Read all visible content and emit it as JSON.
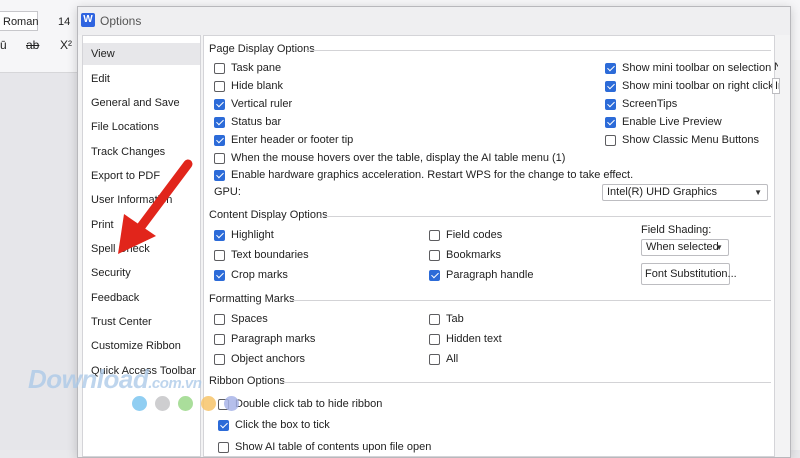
{
  "background": {
    "font_name": "Roman",
    "font_size": "14",
    "underline_glyph": "ū",
    "strike_label": "ab",
    "superscript_label": "X²"
  },
  "dialog": {
    "title": "Options",
    "app_icon_letter": "W"
  },
  "sidebar": {
    "items": [
      {
        "label": "View",
        "active": true
      },
      {
        "label": "Edit"
      },
      {
        "label": "General and Save"
      },
      {
        "label": "File Locations"
      },
      {
        "label": "Track Changes"
      },
      {
        "label": "Export to PDF"
      },
      {
        "label": "User Information"
      },
      {
        "label": "Print"
      },
      {
        "label": "Spell Check"
      },
      {
        "label": "Security"
      },
      {
        "label": "Feedback"
      },
      {
        "label": "Trust Center"
      },
      {
        "label": "Customize Ribbon"
      },
      {
        "label": "Quick Access Toolbar"
      }
    ]
  },
  "page_display": {
    "title": "Page Display Options",
    "left": [
      {
        "label": "Task pane",
        "checked": false
      },
      {
        "label": "Hide blank",
        "checked": false
      },
      {
        "label": "Vertical ruler",
        "checked": true
      },
      {
        "label": "Status bar",
        "checked": true
      },
      {
        "label": "Enter header or footer tip",
        "checked": true
      },
      {
        "label": "When the mouse hovers over the table, display the AI table menu (1)",
        "checked": false
      },
      {
        "label": "Enable hardware graphics acceleration. Restart WPS for the change to take effect.",
        "checked": true
      }
    ],
    "right": [
      {
        "label": "Show mini toolbar on selection",
        "checked": true
      },
      {
        "label": "Show mini toolbar on right click",
        "checked": true
      },
      {
        "label": "ScreenTips",
        "checked": true
      },
      {
        "label": "Enable Live Preview",
        "checked": true
      },
      {
        "label": "Show Classic Menu Buttons",
        "checked": false
      }
    ],
    "edge_box_1": "Nav",
    "edge_box_2": "Inv",
    "gpu_label": "GPU:",
    "gpu_value": "Intel(R) UHD Graphics"
  },
  "content_display": {
    "title": "Content Display Options",
    "col1": [
      {
        "label": "Highlight",
        "checked": true
      },
      {
        "label": "Text boundaries",
        "checked": false
      },
      {
        "label": "Crop marks",
        "checked": true
      }
    ],
    "col2": [
      {
        "label": "Field codes",
        "checked": false
      },
      {
        "label": "Bookmarks",
        "checked": false
      },
      {
        "label": "Paragraph handle",
        "checked": true
      }
    ],
    "field_shading_label": "Field Shading:",
    "field_shading_value": "When selected",
    "font_substitution_label": "Font Substitution..."
  },
  "formatting_marks": {
    "title": "Formatting Marks",
    "col1": [
      {
        "label": "Spaces",
        "checked": false
      },
      {
        "label": "Paragraph marks",
        "checked": false
      },
      {
        "label": "Object anchors",
        "checked": false
      }
    ],
    "col2": [
      {
        "label": "Tab",
        "checked": false
      },
      {
        "label": "Hidden text",
        "checked": false
      },
      {
        "label": "All",
        "checked": false
      }
    ]
  },
  "ribbon": {
    "title": "Ribbon Options",
    "items": [
      {
        "label": "Double click tab to hide ribbon",
        "checked": false
      },
      {
        "label": "Click the box to tick",
        "checked": true
      },
      {
        "label": "Show AI table of contents upon file open",
        "checked": false
      }
    ]
  },
  "watermark": {
    "text": "Download",
    "suffix": ".com.vn",
    "dot_colors": [
      "#7cc5f0",
      "#c5c5c8",
      "#9bd88a",
      "#f7c46a",
      "#a8b4e8"
    ]
  },
  "colors": {
    "accent": "#2c6bd8",
    "arrow": "#e1251b"
  }
}
